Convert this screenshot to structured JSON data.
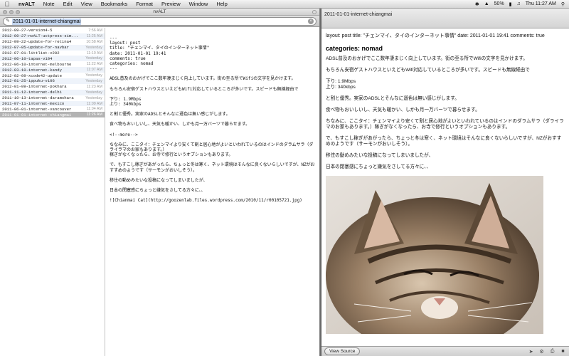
{
  "menubar": {
    "app_name": "nvALT",
    "menus": [
      "Note",
      "Edit",
      "View",
      "Bookmarks",
      "Format",
      "Preview",
      "Window",
      "Help"
    ],
    "battery": "50%",
    "clock": "Thu 11:27 AM"
  },
  "window": {
    "title": "nvALT"
  },
  "search": {
    "value": "2011-01-01-internet-chiangmai"
  },
  "notes": [
    {
      "title": "2012-09-27-version4-5",
      "date": "7:56 AM"
    },
    {
      "title": "2012-09-27-nvALT-uctpress-sim...",
      "date": "11:25 AM"
    },
    {
      "title": "2012-09-22-update-for-retina4",
      "date": "10:58 AM"
    },
    {
      "title": "2012-07-05-update-for-navbar",
      "date": "Yesterday"
    },
    {
      "title": "2012-07-01-littlist-v202",
      "date": "11:10 AM"
    },
    {
      "title": "2012-06-10-tapas-v104",
      "date": "Yesterday"
    },
    {
      "title": "2012-06-10-internet-melbourne",
      "date": "11:22 AM"
    },
    {
      "title": "2012-03-10-internet-kandy",
      "date": "11:07 AM"
    },
    {
      "title": "2012-02-09-xcode42-update",
      "date": "Yesterday"
    },
    {
      "title": "2012-01-25-ippuku-v106",
      "date": "Yesterday"
    },
    {
      "title": "2012-01-09-internet-pokhara",
      "date": "11:23 AM"
    },
    {
      "title": "2011-11-12-internet-delhi",
      "date": "Yesterday"
    },
    {
      "title": "2011-10-13-internet-daramshara",
      "date": "Yesterday"
    },
    {
      "title": "2011-07-11-internet-mexico",
      "date": "11:09 AM"
    },
    {
      "title": "2011-06-01-internet-vancouver",
      "date": "11:04 AM"
    },
    {
      "title": "2011-01-01-internet-chiangmai",
      "date": "11:26 AM"
    }
  ],
  "editor": {
    "lines": [
      "---",
      "layout: post",
      "title: \"チェンマイ、タイのインターネット事情\"",
      "date: 2011-01-01 19:41",
      "comments: true",
      "categories: nomad",
      "---",
      "",
      "ADSL普及のおかげでここ数年凄まじく向上しています。街の至る所でWifiの文字を見かけます。",
      "",
      "もちろん安宿ゲストハウスといえどもWifi対応しているところが多いです。スピードも無線経由で",
      "",
      "下り: 1.9Mbps",
      "上り: 340kbps",
      "",
      "と割と優秀。実家のADSLとそんなに遜色は無い感じがします。",
      "",
      "食べ物もおいしいし、天気も暖かい、しかも月一万バーツで暮らせます。",
      "",
      "<!--more-->",
      "",
      "ちなみに、ここタイ：チェンマイより安くて割と居心地がよいといわれているのはインドのダラムサラ（ダライラマのお家もあります。）",
      "稼ぎがなくなったら、お寺で修行というオプションもあります。",
      "",
      "で、もすこし稼ぎがあがったら、ちょっと冬は寒く、ネット環境はそんなに良くないらしいですが、NZがおすすめのようです（サーモンがおいしそう）。",
      "",
      "移住の動めみたいな投稿になってしまいましたが、",
      "",
      "日本の閉塞感にちょっと嫌気をさしてる方々に、、",
      "",
      "![Chianmai Cat](http://goozenlab.files.wordpress.com/2010/11/r00105721.jpg)"
    ]
  },
  "preview": {
    "title": "2011-01-01-internet-chiangmai",
    "front_matter": "layout: post title: \"チェンマイ、タイのインターネット事情\" date: 2011-01-01 19:41 comments: true",
    "heading": "categories: nomad",
    "paragraphs": [
      "ADSL普及のおかげでここ数年凄まじく向上しています。街の至る所でWifiの文字を見かけます。",
      "もちろん安宿ゲストハウスといえどもWifi対応しているところが多いです。スピードも無線経由で",
      "下り: 1.9Mbps\n上り: 340kbps",
      "と割と優秀。実家のADSLとそんなに遜色は無い感じがします。",
      "食べ物もおいしいし、天気も暖かい、しかも月一万バーツで暮らせます。",
      "ちなみに、ここタイ：チェンマイより安くて割と居心地がよいといわれているのはインドのダラムサラ（ダライラマのお家もあります。）稼ぎがなくなったら、お寺で修行というオプションもあります。",
      "で、もすこし稼ぎがあがったら、ちょっと冬は寒く、ネット環境はそんなに良くないらしいですが、NZがおすすめのようです（サーモンがおいしそう）。",
      "移住の動めみたいな投稿になってしまいましたが、",
      "日本の閉塞感にちょっと嫌気をさしてる方々に、、"
    ],
    "view_source_label": "View Source"
  }
}
